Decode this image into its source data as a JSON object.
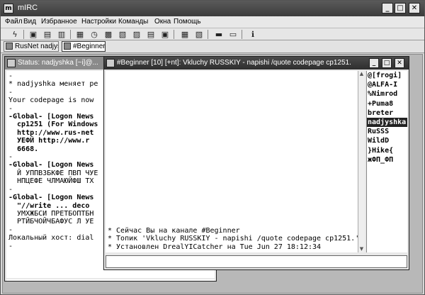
{
  "app": {
    "title": "mIRC"
  },
  "menu": [
    "Файл",
    "Вид",
    "Избранное",
    "Настройки",
    "Команды",
    "Окна",
    "Помощь"
  ],
  "toolbar_icons": [
    "connect-icon",
    "options-icon",
    "favorites-icon",
    "chanlist-icon",
    "address-book-icon",
    "timer-icon",
    "colors-icon",
    "script-editor-icon",
    "dcc-send-icon",
    "dcc-chat-icon",
    "notify-icon",
    "urls-icon",
    "tile-icon",
    "cascade-icon",
    "help-icon"
  ],
  "switchbar": {
    "tabs": [
      {
        "label": "RusNet nadjys..."
      },
      {
        "label": "#Beginner"
      }
    ]
  },
  "status_window": {
    "title": "Status: nadjyshka [~i]@...",
    "lines": [
      "-",
      "* nadjyshka меняет ре",
      "-",
      "Your codepage is now",
      "-",
      "-Global- [Logon News",
      "  cp1251 (For Windows",
      "  http://www.rus-net",
      "  УЕФЙ http://www.r",
      "  6668.",
      "-",
      "-Global- [Logon News",
      "  Й УППВЗБКФЕ ПВП ЧУЕ",
      "  НПЦЕФЕ ЧЛМАЮЙФШ ТХ",
      "-",
      "-Global- [Logon News",
      "  \"//write ... deco",
      "  УМХЖБСИ ПРЕТБОПТБН",
      "  РТЙБЧОЙЧБАФУС Л УЕ",
      "-",
      "Локальный хост: dial",
      "-"
    ]
  },
  "channel_window": {
    "title": "#Beginner [10] [+nt]: Vkluchy RUSSKIY - napishi /quote codepage cp1251.",
    "messages": [
      "* Сейчас Вы на канале #Beginner",
      "* Топик 'Vkluchy RUSSKIY - napishi /quote codepage cp1251.'",
      "* Установлен DrealYICatcher на Tue Jun 27 18:12:34"
    ],
    "nicks": [
      "@[frogi]",
      "@ALFA-I",
      "%Nimrod",
      "+Puma8",
      "breter",
      "nadjyshka",
      "RuSSS",
      "WildD",
      "}Hike{",
      "жФП_ФП"
    ],
    "selected_nick": "nadjyshka",
    "input_value": ""
  },
  "glyphs": {
    "minimize": "_",
    "maximize": "□",
    "close": "✕",
    "scroll_up": "▲",
    "scroll_down": "▼"
  },
  "colors": {
    "active_title": "#3c3c3c",
    "inactive_title": "#8a8a8a",
    "selected_nick_bg": "#222222"
  }
}
